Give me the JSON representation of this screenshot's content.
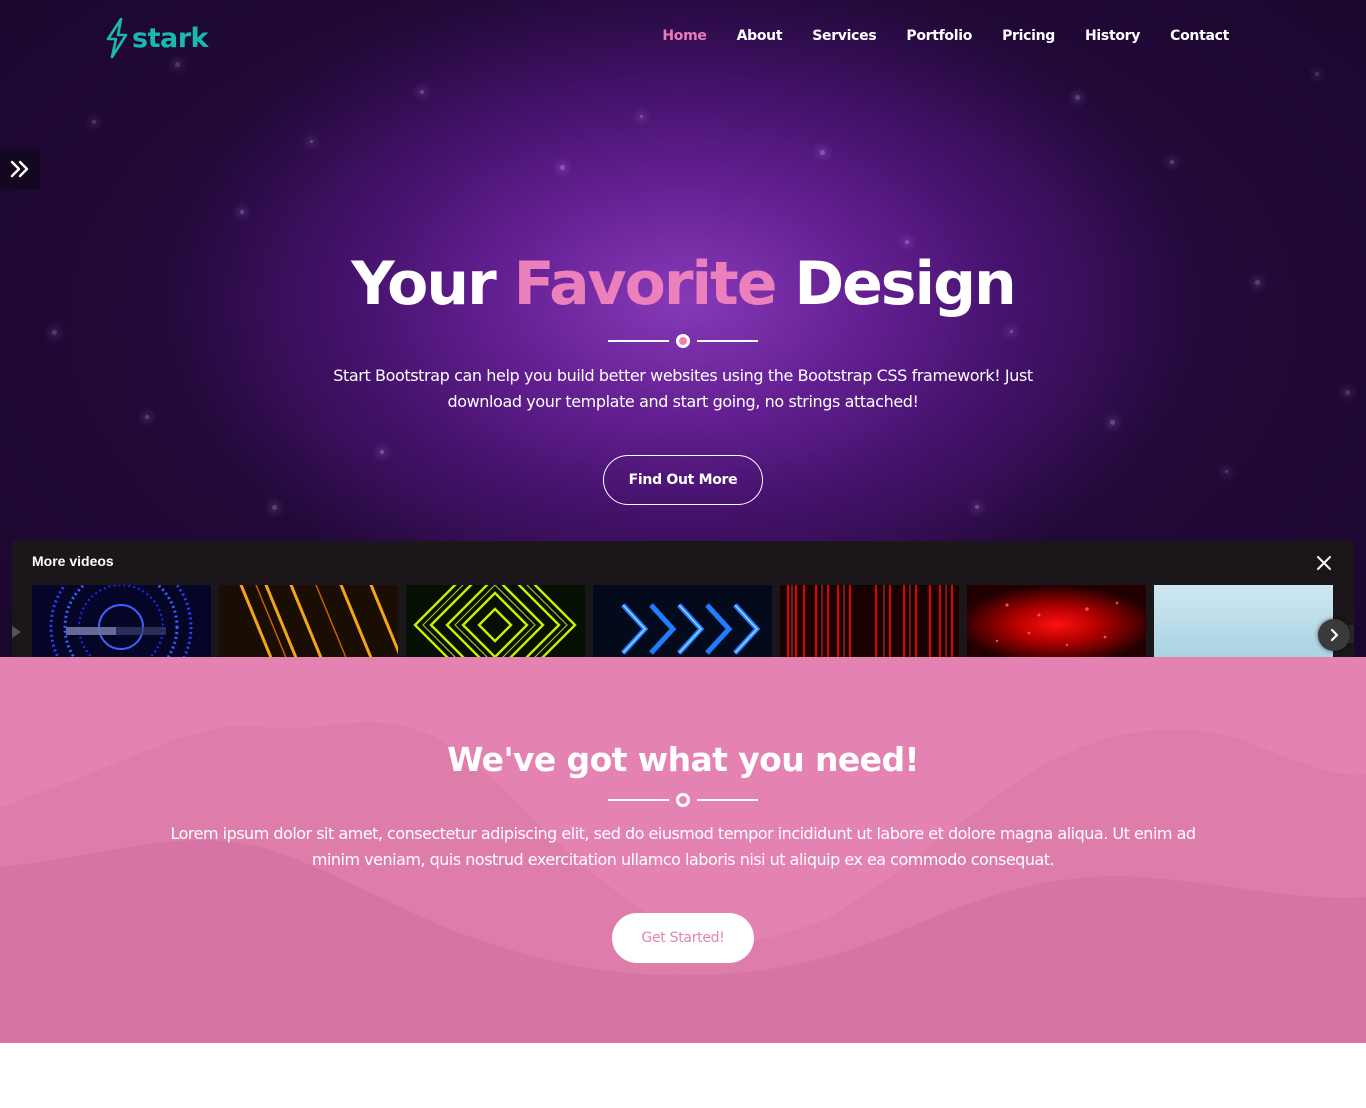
{
  "brand": {
    "name": "stark",
    "color": "#19b9b0"
  },
  "nav": {
    "items": [
      {
        "label": "Home",
        "active": true
      },
      {
        "label": "About"
      },
      {
        "label": "Services"
      },
      {
        "label": "Portfolio"
      },
      {
        "label": "Pricing"
      },
      {
        "label": "History"
      },
      {
        "label": "Contact"
      }
    ],
    "active_color": "#ec80bd"
  },
  "side_toggle": {
    "icon": "double-chevron-right-icon"
  },
  "hero": {
    "title_part1": "Your",
    "title_accent": "Favorite",
    "title_part3": "Design",
    "text": "Start Bootstrap can help you build better websites using the Bootstrap CSS framework! Just download your template and start going, no strings attached!",
    "button_label": "Find Out More"
  },
  "videos": {
    "title": "More videos",
    "close_icon": "close-icon",
    "next_icon": "chevron-right-icon",
    "thumbnails": [
      {
        "name": "blue-circles-thumbnail"
      },
      {
        "name": "orange-neon-lines-thumbnail"
      },
      {
        "name": "yellow-diamonds-thumbnail"
      },
      {
        "name": "blue-chevrons-thumbnail"
      },
      {
        "name": "red-curtain-thumbnail"
      },
      {
        "name": "red-particles-thumbnail"
      },
      {
        "name": "light-blue-sky-thumbnail"
      }
    ]
  },
  "section": {
    "title": "We've got what you need!",
    "text": "Lorem ipsum dolor sit amet, consectetur adipiscing elit, sed do eiusmod tempor incididunt ut labore et dolore magna aliqua. Ut enim ad minim veniam, quis nostrud exercitation ullamco laboris nisi ut aliquip ex ea commodo consequat.",
    "button_label": "Get Started!",
    "background": "#e483b1"
  }
}
